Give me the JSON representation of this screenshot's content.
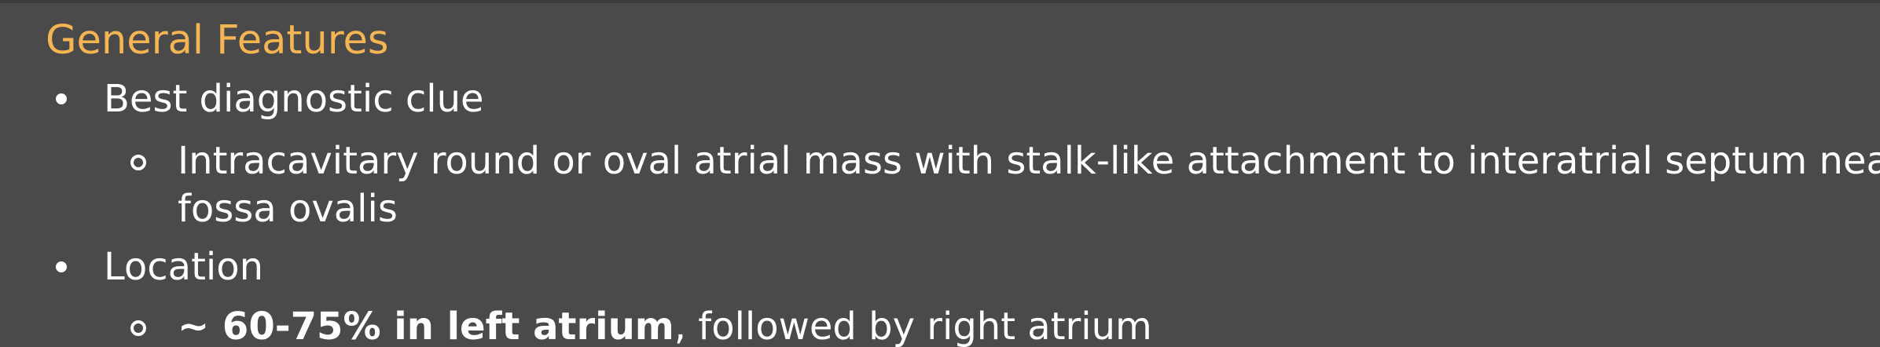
{
  "title": "General Features",
  "bullets": [
    {
      "label": "Best diagnostic clue",
      "sub": {
        "line1": "Intracavitary round or oval atrial mass with stalk-like attachment to interatrial septum near",
        "line2": "fossa ovalis"
      }
    },
    {
      "label": "Location",
      "sub": {
        "bold": "~ 60-75% in left atrium",
        "rest": ", followed by right atrium"
      }
    }
  ],
  "colors": {
    "background": "#4a4a4a",
    "title": "#f5b553",
    "text": "#ffffff"
  }
}
